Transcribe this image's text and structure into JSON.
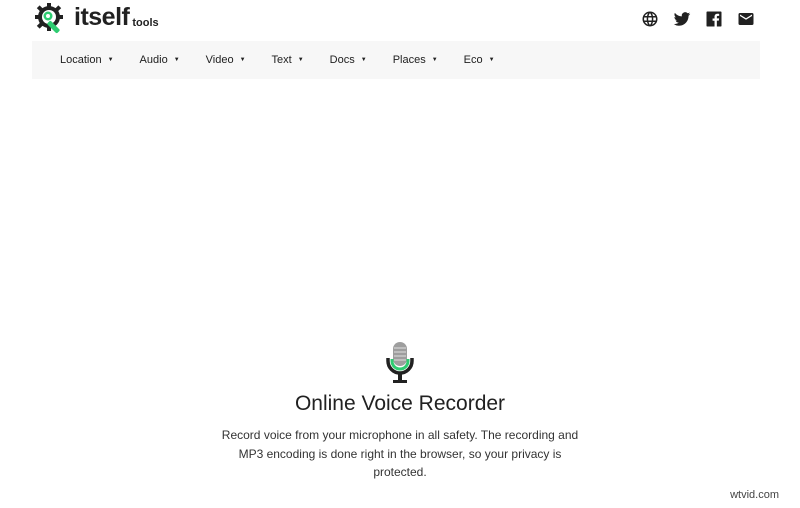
{
  "header": {
    "logo_text": "itself",
    "logo_sub": "tools",
    "icons": [
      "globe-icon",
      "twitter-icon",
      "facebook-icon",
      "mail-icon"
    ]
  },
  "nav": {
    "items": [
      {
        "label": "Location"
      },
      {
        "label": "Audio"
      },
      {
        "label": "Video"
      },
      {
        "label": "Text"
      },
      {
        "label": "Docs"
      },
      {
        "label": "Places"
      },
      {
        "label": "Eco"
      }
    ],
    "caret": "▼"
  },
  "hero": {
    "title": "Online Voice Recorder",
    "description": "Record voice from your microphone in all safety. The recording and MP3 encoding is done right in the browser, so your privacy is protected."
  },
  "watermark": "wtvid.com",
  "colors": {
    "accent": "#2ecc71",
    "text": "#212121",
    "nav_bg": "#f7f7f7"
  }
}
